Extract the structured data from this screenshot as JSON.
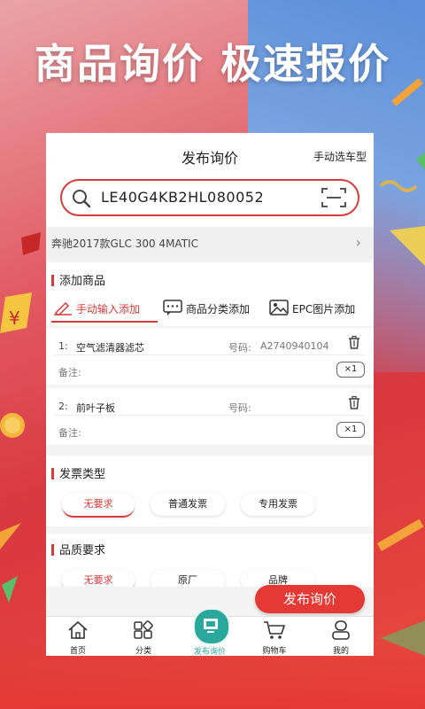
{
  "headline": "商品询价 极速报价",
  "colors": {
    "accent": "#d53d3d",
    "button": "#e53935",
    "teal": "#2aa89b"
  },
  "header": {
    "title": "发布询价",
    "right_action": "手动选车型"
  },
  "search": {
    "value": "LE40G4KB2HL080052",
    "left_icon": "search-icon",
    "right_icon": "scan-icon"
  },
  "vehicle": {
    "name": "奔驰2017款GLC 300 4MATIC"
  },
  "add_goods": {
    "title": "添加商品",
    "tabs": [
      {
        "label": "手动输入添加",
        "icon": "pen-icon",
        "active": true
      },
      {
        "label": "商品分类添加",
        "icon": "chat-dots-icon",
        "active": false
      },
      {
        "label": "EPC图片添加",
        "icon": "image-icon",
        "active": false
      }
    ],
    "items": [
      {
        "index": "1:",
        "name": "空气滤清器滤芯",
        "code_label": "号码:",
        "code": "A2740940104",
        "note_label": "备注:",
        "qty": "×1"
      },
      {
        "index": "2:",
        "name": "前叶子板",
        "code_label": "号码:",
        "code": "",
        "note_label": "备注:",
        "qty": "×1"
      }
    ]
  },
  "invoice": {
    "title": "发票类型",
    "options": [
      "无要求",
      "普通发票",
      "专用发票"
    ],
    "selected": "无要求"
  },
  "quality": {
    "title": "品质要求",
    "options": [
      "无要求",
      "原厂",
      "品牌"
    ],
    "selected": "无要求"
  },
  "publish_button": "发布询价",
  "tabbar": [
    {
      "label": "首页",
      "icon": "home-icon"
    },
    {
      "label": "分类",
      "icon": "category-icon"
    },
    {
      "label": "发布询价",
      "icon": "publish-icon"
    },
    {
      "label": "购物车",
      "icon": "cart-icon"
    },
    {
      "label": "我的",
      "icon": "user-icon"
    }
  ]
}
